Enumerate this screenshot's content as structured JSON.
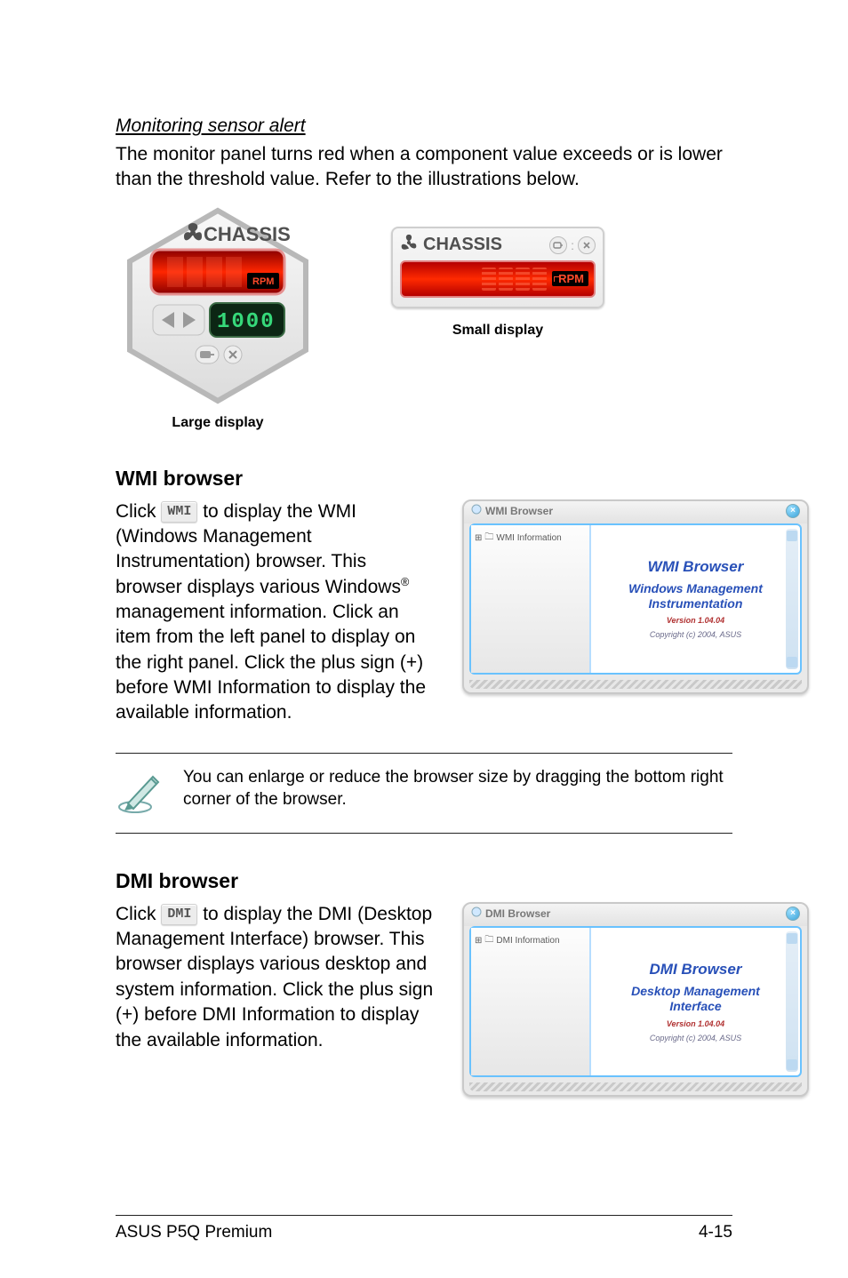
{
  "alert": {
    "heading": "Monitoring sensor alert",
    "body": "The monitor panel turns red when a component value exceeds or is lower than the threshold value. Refer to the illustrations below."
  },
  "displays": {
    "large": {
      "title": "CHASSIS",
      "value": "1000",
      "unit": "RPM",
      "caption": "Large display"
    },
    "small": {
      "title": "CHASSIS",
      "value_segments": 4,
      "unit": "RPM",
      "caption": "Small display"
    }
  },
  "wmi": {
    "heading": "WMI browser",
    "btn": "WMI",
    "body_prefix": "Click ",
    "body_after_btn": " to display the WMI (Windows Management Instrumentation) browser. This browser displays various Windows",
    "body_sup": "®",
    "body_rest": " management information. Click an item from the left panel to display on the right panel. Click the plus sign (+) before WMI Information to display the available information.",
    "window": {
      "titlebar": "WMI Browser",
      "tree_item": "WMI Information",
      "title1": "WMI  Browser",
      "title2": "Windows Management\nInstrumentation",
      "version": "Version 1.04.04",
      "copyright": "Copyright (c) 2004,  ASUS"
    }
  },
  "note": {
    "text": "You can enlarge or reduce the browser size by dragging the bottom right corner of the browser."
  },
  "dmi": {
    "heading": "DMI browser",
    "btn": "DMI",
    "body_prefix": "Click ",
    "body_after_btn": " to display the DMI (Desktop Management Interface) browser. This browser displays various desktop and system information. Click the plus sign (+) before DMI Information to display the available information.",
    "window": {
      "titlebar": "DMI Browser",
      "tree_item": "DMI Information",
      "title1": "DMI  Browser",
      "title2": "Desktop Management\nInterface",
      "version": "Version 1.04.04",
      "copyright": "Copyright (c) 2004,  ASUS"
    }
  },
  "footer": {
    "left": "ASUS P5Q Premium",
    "right": "4-15"
  }
}
